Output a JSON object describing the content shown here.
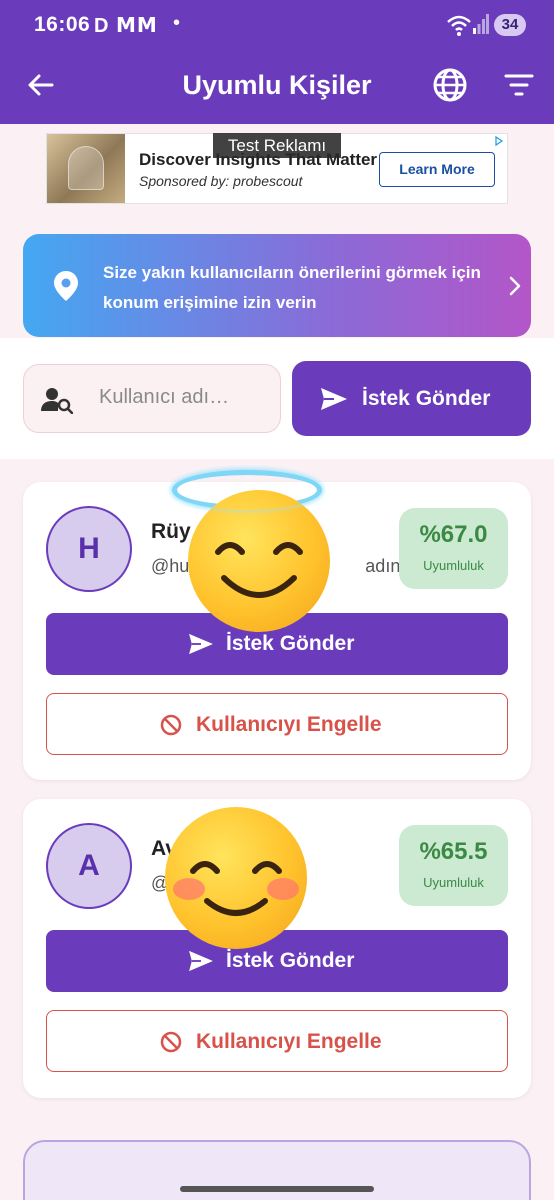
{
  "status_bar": {
    "time": "16:06",
    "notif_icons": "D ⅯⅯ",
    "battery": "34"
  },
  "app_bar": {
    "title": "Uyumlu Kişiler"
  },
  "ad": {
    "label": "Test Reklamı",
    "headline": "Discover Insights That Matter",
    "sponsor": "Sponsored by: probescout",
    "cta": "Learn More"
  },
  "location_banner": {
    "text": "Size yakın kullanıcıların önerilerini görmek için konum erişimine izin verin"
  },
  "search": {
    "placeholder": "Kullanıcı adı…",
    "send_label": "İstek Gönder"
  },
  "users": [
    {
      "initial": "H",
      "name": "Rüy",
      "handle": "@hu",
      "handle_suffix": "adın",
      "compatibility": "%67.0",
      "compatibility_label": "Uyumluluk",
      "request_label": "İstek Gönder",
      "block_label": "Kullanıcıyı Engelle"
    },
    {
      "initial": "A",
      "name": "Av",
      "handle": "@",
      "handle_suffix": "",
      "compatibility": "%65.5",
      "compatibility_label": "Uyumluluk",
      "request_label": "İstek Gönder",
      "block_label": "Kullanıcıyı Engelle"
    }
  ],
  "colors": {
    "primary": "#6a3cbc",
    "danger": "#d8524a",
    "match_bg": "#cce9d2",
    "match_text": "#3a8a44"
  }
}
